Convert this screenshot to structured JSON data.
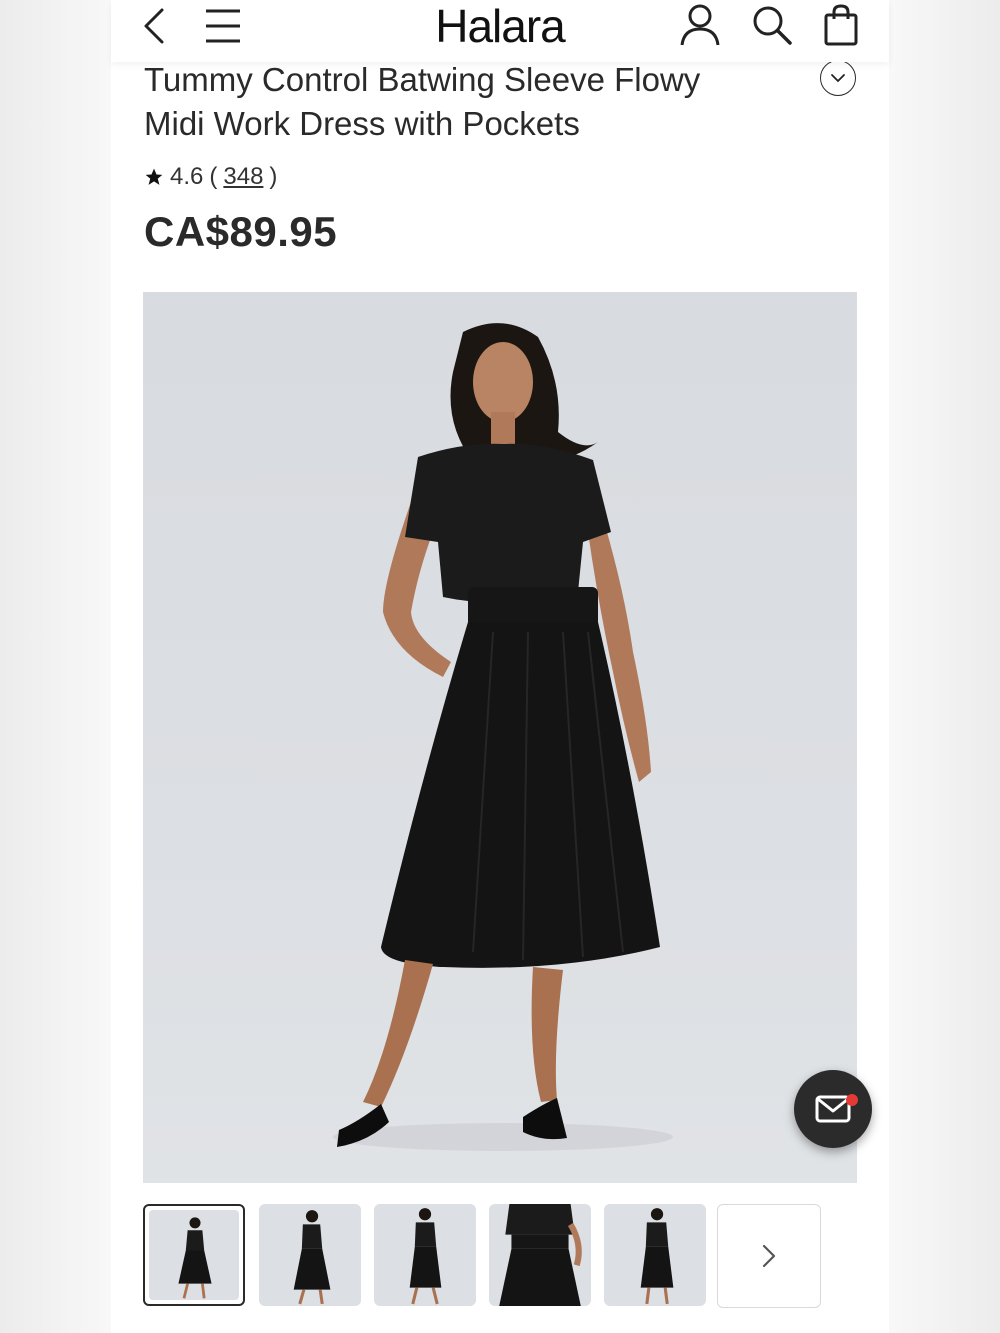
{
  "header": {
    "logo": "Halara",
    "icons": [
      "back-arrow-icon",
      "hamburger-menu-icon",
      "account-icon",
      "search-icon",
      "shopping-bag-icon"
    ]
  },
  "product": {
    "title_line1": "Tummy Control Batwing Sleeve Flowy",
    "title_line2": "Midi Work Dress with Pockets",
    "rating": "4.6",
    "rating_open": "(",
    "review_count": "348",
    "rating_close": ")",
    "price": "CA$89.95"
  },
  "gallery": {
    "thumbnail_count": 5,
    "selected_index": 0
  },
  "colors": {
    "text": "#2a2a2a",
    "image_bg": "#dcdfe3",
    "fab_bg": "#2b2b2b",
    "notify_dot": "#e53935"
  }
}
